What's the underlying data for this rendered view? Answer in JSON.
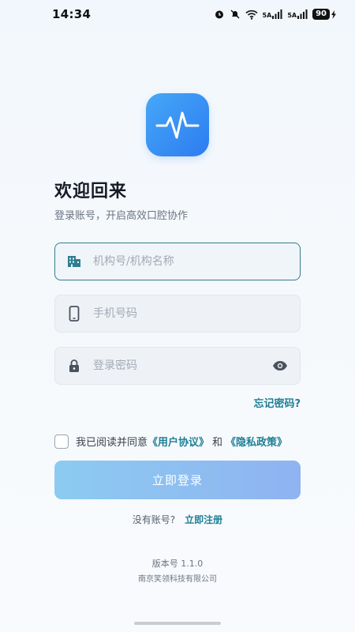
{
  "status_bar": {
    "time": "14:34",
    "network1": "5A",
    "network2": "5A",
    "battery": "90"
  },
  "app": {
    "logo_icon": "pulse-wave-icon",
    "brand_color": "#2c7cf0"
  },
  "welcome": {
    "title": "欢迎回来",
    "subtitle": "登录账号，开启高效口腔协作"
  },
  "form": {
    "org_placeholder": "机构号/机构名称",
    "phone_placeholder": "手机号码",
    "password_placeholder": "登录密码",
    "forgot_label": "忘记密码?"
  },
  "agreement": {
    "prefix": "我已阅读并同意",
    "user_agreement": "《用户协议》",
    "and": "和",
    "privacy_policy": "《隐私政策》"
  },
  "login_button_label": "立即登录",
  "register": {
    "prompt": "没有账号?",
    "link": "立即注册"
  },
  "footer": {
    "version": "版本号 1.1.0",
    "company": "南京笑领科技有限公司"
  },
  "colors": {
    "accent": "#1e7f95",
    "button_gradient_start": "#8ccbf1",
    "button_gradient_end": "#8fb3f1"
  }
}
